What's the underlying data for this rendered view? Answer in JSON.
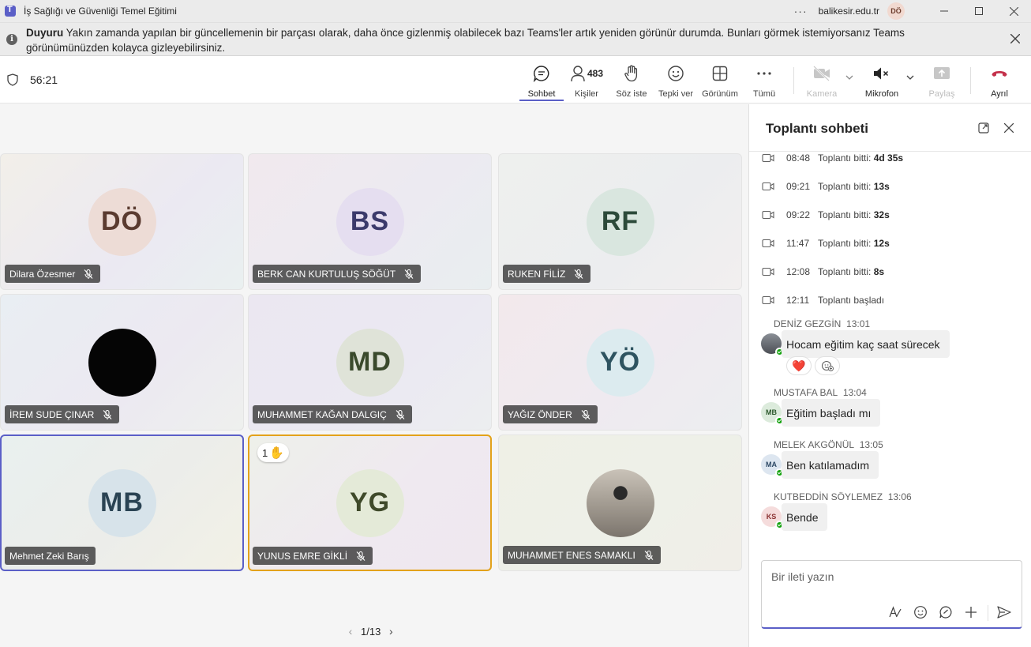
{
  "window": {
    "title": "İş Sağlığı ve Güvenliği Temel Eğitimi",
    "more_glyph": "···",
    "org": "balikesir.edu.tr",
    "user_initials": "DÖ"
  },
  "banner": {
    "heading": "Duyuru",
    "text": " Yakın zamanda yapılan bir güncellemenin bir parçası olarak, daha önce gizlenmiş olabilecek bazı Teams'ler artık yeniden görünür durumda. Bunları görmek istemiyorsanız Teams görünümünüzden kolayca gizleyebilirsiniz."
  },
  "toolbar": {
    "timer": "56:21",
    "chat_label": "Sohbet",
    "people_label": "Kişiler",
    "people_count": "483",
    "raise_hand_label": "Söz iste",
    "react_label": "Tepki ver",
    "view_label": "Görünüm",
    "more_label": "Tümü",
    "camera_label": "Kamera",
    "mic_label": "Mikrofon",
    "share_label": "Paylaş",
    "leave_label": "Ayrıl"
  },
  "colors": {
    "accent": "#5b5fc7",
    "raised_hand_border": "#e3a21a",
    "leave_red": "#c4314b",
    "presence_green": "#13a10e"
  },
  "participants": [
    {
      "name": "Dilara Özesmer",
      "initials": "DÖ"
    },
    {
      "name": "BERK CAN KURTULUŞ SÖĞÜT",
      "initials": "BS"
    },
    {
      "name": "RUKEN FİLİZ",
      "initials": "RF"
    },
    {
      "name": "İREM SUDE ÇINAR",
      "initials": ""
    },
    {
      "name": "MUHAMMET KAĞAN DALGIÇ",
      "initials": "MD"
    },
    {
      "name": "YAĞIZ ÖNDER",
      "initials": "YÖ"
    },
    {
      "name": "Mehmet Zeki Barış",
      "initials": "MB"
    },
    {
      "name": "YUNUS EMRE GİKLİ",
      "initials": "YG",
      "hand_order": "1"
    },
    {
      "name": "MUHAMMET ENES SAMAKLI",
      "initials": ""
    }
  ],
  "pager": {
    "text": "1/13"
  },
  "chat": {
    "title": "Toplantı sohbeti",
    "events": [
      {
        "time": "08:48",
        "text": "Toplantı bitti: ",
        "bold": "4d 35s"
      },
      {
        "time": "09:21",
        "text": "Toplantı bitti: ",
        "bold": "13s"
      },
      {
        "time": "09:22",
        "text": "Toplantı bitti: ",
        "bold": "32s"
      },
      {
        "time": "11:47",
        "text": "Toplantı bitti: ",
        "bold": "12s"
      },
      {
        "time": "12:08",
        "text": "Toplantı bitti: ",
        "bold": "8s"
      },
      {
        "time": "12:11",
        "text": "Toplantı başladı",
        "bold": ""
      }
    ],
    "messages": [
      {
        "sender": "DENİZ GEZGİN",
        "time": "13:01",
        "initials": "",
        "text": "Hocam eğitim kaç saat sürecek",
        "reaction": "❤️"
      },
      {
        "sender": "MUSTAFA BAL",
        "time": "13:04",
        "initials": "MB",
        "text": "Eğitim başladı mı"
      },
      {
        "sender": "MELEK AKGÖNÜL",
        "time": "13:05",
        "initials": "MA",
        "text": "Ben katılamadım"
      },
      {
        "sender": "KUTBEDDİN SÖYLEMEZ",
        "time": "13:06",
        "initials": "KS",
        "text": "Bende"
      }
    ],
    "composer_placeholder": "Bir ileti yazın"
  }
}
